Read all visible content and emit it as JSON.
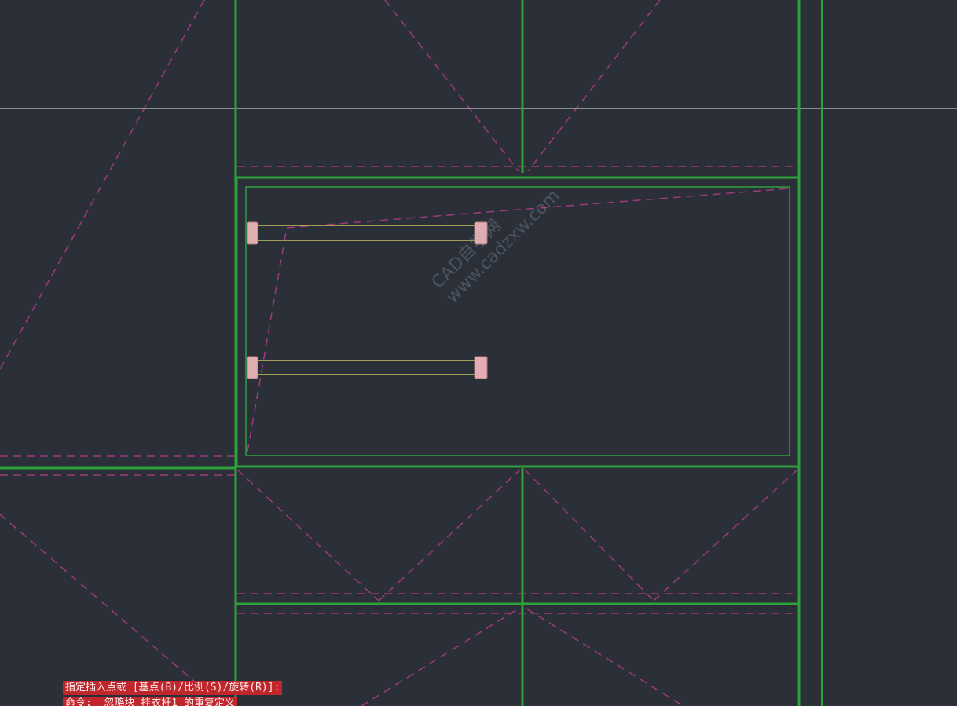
{
  "colors": {
    "background": "#2a2f38",
    "cabinet_lines": "#2fa13a",
    "dashed_hidden_lines": "#a0397e",
    "crosshair": "#a9acb2",
    "hanging_rod": "#c8c25a",
    "rod_end_cap": "#e3aeb1",
    "command_highlight": "#c0272d"
  },
  "command_line": {
    "prompt": "指定插入点或 [基点(B)/比例(S)/旋转(R)]:",
    "history": "命令: _忽略块 挂衣杆1 的重复定义"
  },
  "watermark": {
    "line1": "CAD自学网",
    "line2": "www.cadzxw.com"
  },
  "objects": {
    "rod_block_name": "挂衣杆1",
    "rod_count": 2
  }
}
